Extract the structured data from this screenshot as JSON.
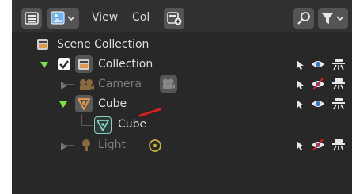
{
  "header": {
    "view_label": "View",
    "col_label": "Col"
  },
  "tree": {
    "scene_collection": {
      "label": "Scene Collection"
    },
    "collection": {
      "label": "Collection",
      "checked": true
    },
    "camera": {
      "label": "Camera",
      "hidden": true
    },
    "cube_object": {
      "label": "Cube",
      "selected": true
    },
    "cube_mesh": {
      "label": "Cube"
    },
    "light": {
      "label": "Light",
      "hidden": true
    }
  },
  "colors": {
    "panel_bg": "#282828",
    "header_bg": "#303030",
    "orange": "#d08a40",
    "green_mesh": "#5fb6a0",
    "eye_blue": "#5f8fd0",
    "red_strike": "#d82020"
  }
}
